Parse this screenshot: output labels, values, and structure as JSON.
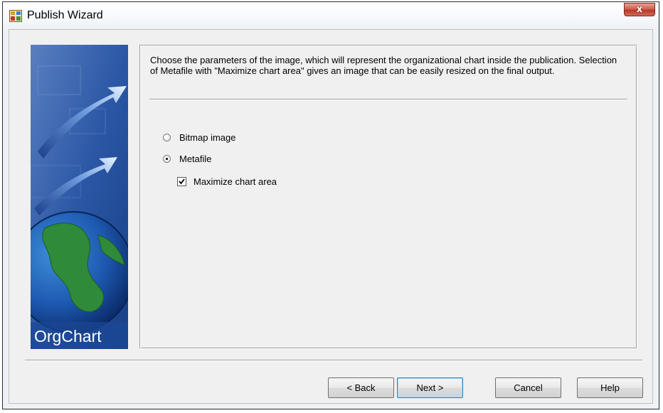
{
  "window": {
    "title": "Publish Wizard",
    "close_glyph": "x"
  },
  "banner": {
    "brand": "OrgChart",
    "image": "orgchart-globe-arrows-banner"
  },
  "description": "Choose the parameters of the image, which will represent the organizational chart inside the publication.  Selection of Metafile with \"Maximize chart area\" gives an image that can be easily resized on the final output.",
  "options": {
    "bitmap": {
      "label": "Bitmap image",
      "selected": false
    },
    "metafile": {
      "label": "Metafile",
      "selected": true
    },
    "maximize": {
      "label": "Maximize chart area",
      "checked": true
    }
  },
  "buttons": {
    "back": "< Back",
    "next": "Next >",
    "cancel": "Cancel",
    "help": "Help"
  },
  "colors": {
    "banner_blue": "#1f4f9c",
    "close_red": "#c9473a"
  }
}
